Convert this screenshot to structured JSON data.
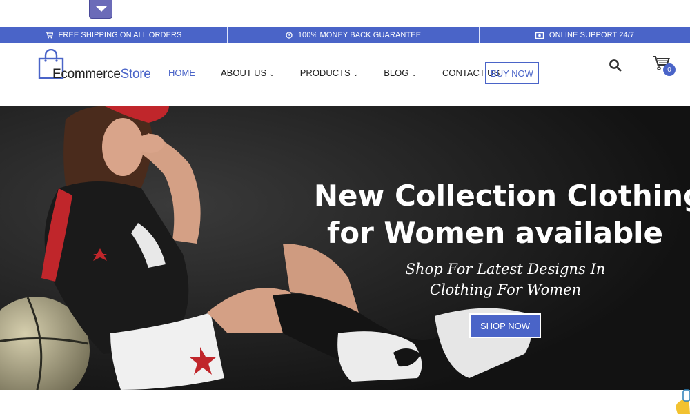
{
  "top_toggle": {
    "icon": "caret-down-icon"
  },
  "topbar": {
    "shipping": {
      "icon": "cart-icon",
      "text": "FREE SHIPPING ON ALL ORDERS"
    },
    "guarantee": {
      "icon": "clock-icon",
      "text": "100% MONEY BACK GUARANTEE"
    },
    "support": {
      "icon": "money-icon",
      "text": "ONLINE SUPPORT 24/7"
    }
  },
  "logo": {
    "part1": "Ecommerce",
    "part2": "Store"
  },
  "nav": {
    "home": "HOME",
    "about": "ABOUT US",
    "products": "PRODUCTS",
    "blog": "BLOG",
    "contact": "CONTACT US",
    "caret": "⌄"
  },
  "buy_now": "BUY NOW",
  "cart": {
    "count": "0"
  },
  "hero": {
    "title_line1": "New Collection Clothing",
    "title_line2": "for Women available",
    "subtitle": "Shop For Latest Designs In Clothing For Women",
    "button": "SHOP NOW"
  },
  "colors": {
    "accent": "#4a64c8",
    "toggle": "#6b6bb8",
    "hero_bg": "#141414"
  }
}
